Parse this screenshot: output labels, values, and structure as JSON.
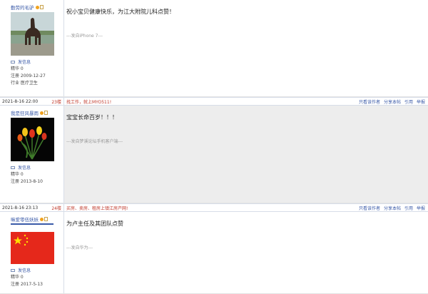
{
  "posts": [
    {
      "username": "勤劳的毛驴",
      "message_link": "发信息",
      "essence": "精华 0",
      "registered": "注册 2009-12-27",
      "industry": "行业 医疗卫生",
      "content": "祝小宝贝健康快乐，为江大附院儿科点赞！",
      "signature": "---发自iPhone 7---"
    },
    {
      "username": "我是狂风暴雨",
      "message_link": "发信息",
      "essence": "精华 0",
      "registered": "注册 2013-8-10",
      "content": "宝宝长命百岁！！！",
      "signature": "---发自梦溪论坛手机客户端---"
    },
    {
      "username": "嘛爱零伍妖妖",
      "message_link": "发信息",
      "essence": "精华 0",
      "registered": "注册 2017-5-13",
      "content": "为卢主任及其团队点赞",
      "signature": "---发自华为---"
    }
  ],
  "meta_rows": [
    {
      "date": "2021-8-16 22:00",
      "floor": "23楼",
      "ad": "找工作，就上MYO511!"
    },
    {
      "date": "2021-8-16 23:13",
      "floor": "24楼",
      "ad": "买房、卖房、租房上镇江房产网!"
    }
  ],
  "actions": {
    "only_author": "只看该作者",
    "share": "分享本帖",
    "quote": "引用",
    "report": "举报"
  },
  "colors": {
    "link_blue": "#3a5aa8",
    "ad_red": "#c0392b",
    "alt_bg": "#ededed"
  }
}
